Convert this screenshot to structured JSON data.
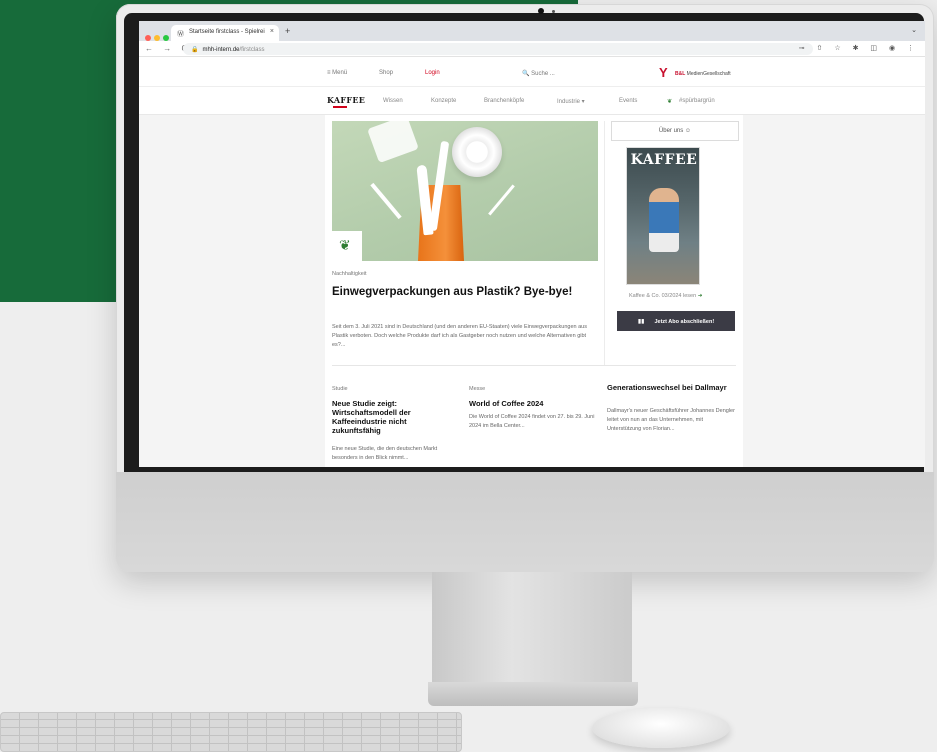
{
  "browser": {
    "tab_title": "Startseite firstclass - Spielrei",
    "tab_close": "×",
    "new_tab": "+",
    "chevron": "⌄",
    "nav_icons": "← → C",
    "url_host": "mhh-intern.de",
    "url_path": "/firstclass",
    "tool_icons": "⊸ ⇧ ☆ ✱ ◫ ◉ ⋮"
  },
  "topnav": {
    "menu": "≡ Menü",
    "shop": "Shop",
    "login": "Login",
    "search": "🔍 Suche ...",
    "brand_prefix": "B&L",
    "brand_text": "MedienGesellschaft"
  },
  "subnav": {
    "logo": "KAFFEE",
    "items": [
      "Wissen",
      "Konzepte",
      "Branchenköpfe",
      "Industrie ▾",
      "Events",
      "#spürbargrün"
    ]
  },
  "featured": {
    "category": "Nachhaltigkeit",
    "title": "Einwegverpackungen aus Plastik? Bye-bye!",
    "excerpt": "Seit dem 3. Juli 2021 sind in Deutschland (und den anderen EU-Staaten) viele Einwegverpackungen aus Plastik verboten. Doch welche Produkte darf ich als Gastgeber noch nutzen und welche Alternativen gibt es?..."
  },
  "sidebar": {
    "about": "Über uns ☺",
    "magazine_title": "KAFFEE",
    "magazine_link": "Kaffee & Co. 03/2024 lesen",
    "magazine_arrow": "➜",
    "abo_button": "Jetzt Abo abschließen!",
    "abo_icon": "▮▮"
  },
  "articles": [
    {
      "category": "Studie",
      "title": "Neue Studie zeigt: Wirtschaftsmodell der Kaffeeindustrie nicht zukunftsfähig",
      "excerpt": "Eine neue Studie, die den deutschen Markt besonders in den Blick nimmt..."
    },
    {
      "category": "Messe",
      "title": "World of Coffee 2024",
      "excerpt": "Die World of Coffee 2024 findet von 27. bis 29. Juni 2024 im Bella Center..."
    },
    {
      "category": "",
      "title": "Generationswechsel bei Dallmayr",
      "excerpt": "Dallmayr's neuer Geschäftsführer Johannes Dengler leitet von nun an das Unternehmen, mit Unterstützung von Florian..."
    }
  ],
  "colors": {
    "accent_green": "#176b3a",
    "login_red": "#d0021b",
    "button_dark": "#3b3b45"
  }
}
